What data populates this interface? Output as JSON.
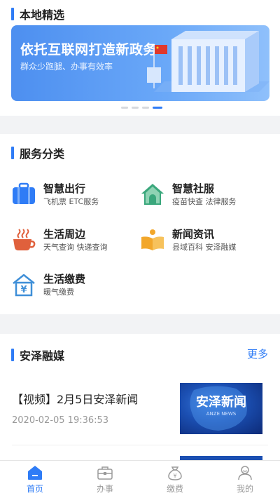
{
  "local_picks": {
    "title": "本地精选",
    "banner": {
      "title": "依托互联网打造新政务",
      "subtitle": "群众少跑腿、办事有效率"
    },
    "carousel": {
      "count": 4,
      "active_index": 3
    }
  },
  "services": {
    "title": "服务分类",
    "items": [
      {
        "name": "智慧出行",
        "desc": "飞机票  ETC服务",
        "icon": "suitcase-icon"
      },
      {
        "name": "智慧社服",
        "desc": "疫苗快查  法律服务",
        "icon": "home-icon"
      },
      {
        "name": "生活周边",
        "desc": "天气查询  快递查询",
        "icon": "coffee-cup-icon"
      },
      {
        "name": "新闻资讯",
        "desc": "县域百科  安泽融媒",
        "icon": "open-book-icon"
      },
      {
        "name": "生活缴费",
        "desc": "暖气缴费",
        "icon": "yuan-house-icon"
      }
    ]
  },
  "media": {
    "title": "安泽融媒",
    "more_label": "更多",
    "news": [
      {
        "title": "【视频】2月5日安泽新闻",
        "date": "2020-02-05 19:36:53",
        "thumb_text": "安泽新闻",
        "thumb_sub": "ANZE NEWS"
      }
    ]
  },
  "tabbar": {
    "items": [
      {
        "label": "首页",
        "icon": "home-icon",
        "active": true
      },
      {
        "label": "办事",
        "icon": "briefcase-icon",
        "active": false
      },
      {
        "label": "缴费",
        "icon": "money-bag-icon",
        "active": false
      },
      {
        "label": "我的",
        "icon": "user-icon",
        "active": false
      }
    ]
  },
  "colors": {
    "accent": "#2f7cf6",
    "banner": "#5a9af4"
  }
}
